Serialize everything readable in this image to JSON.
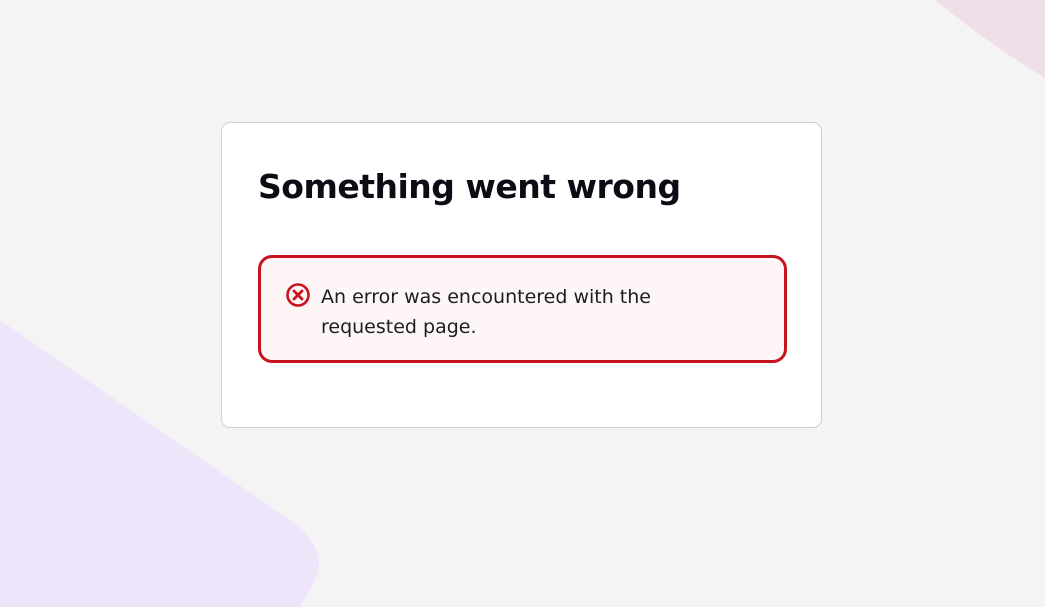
{
  "colors": {
    "page_background": "#f4f4f4",
    "card_background": "#ffffff",
    "card_border": "#cfcfcf",
    "error_border": "#c8141e",
    "error_background": "#fdf5f6",
    "heading_text": "#0b0c14",
    "body_text": "#1c1c24",
    "decor_purple": "#efe5fb",
    "decor_pink": "#efdfe8"
  },
  "error_card": {
    "title": "Something went wrong",
    "alert": {
      "icon": "error-circle-x-icon",
      "message": "An error was encountered with the requested page."
    }
  }
}
